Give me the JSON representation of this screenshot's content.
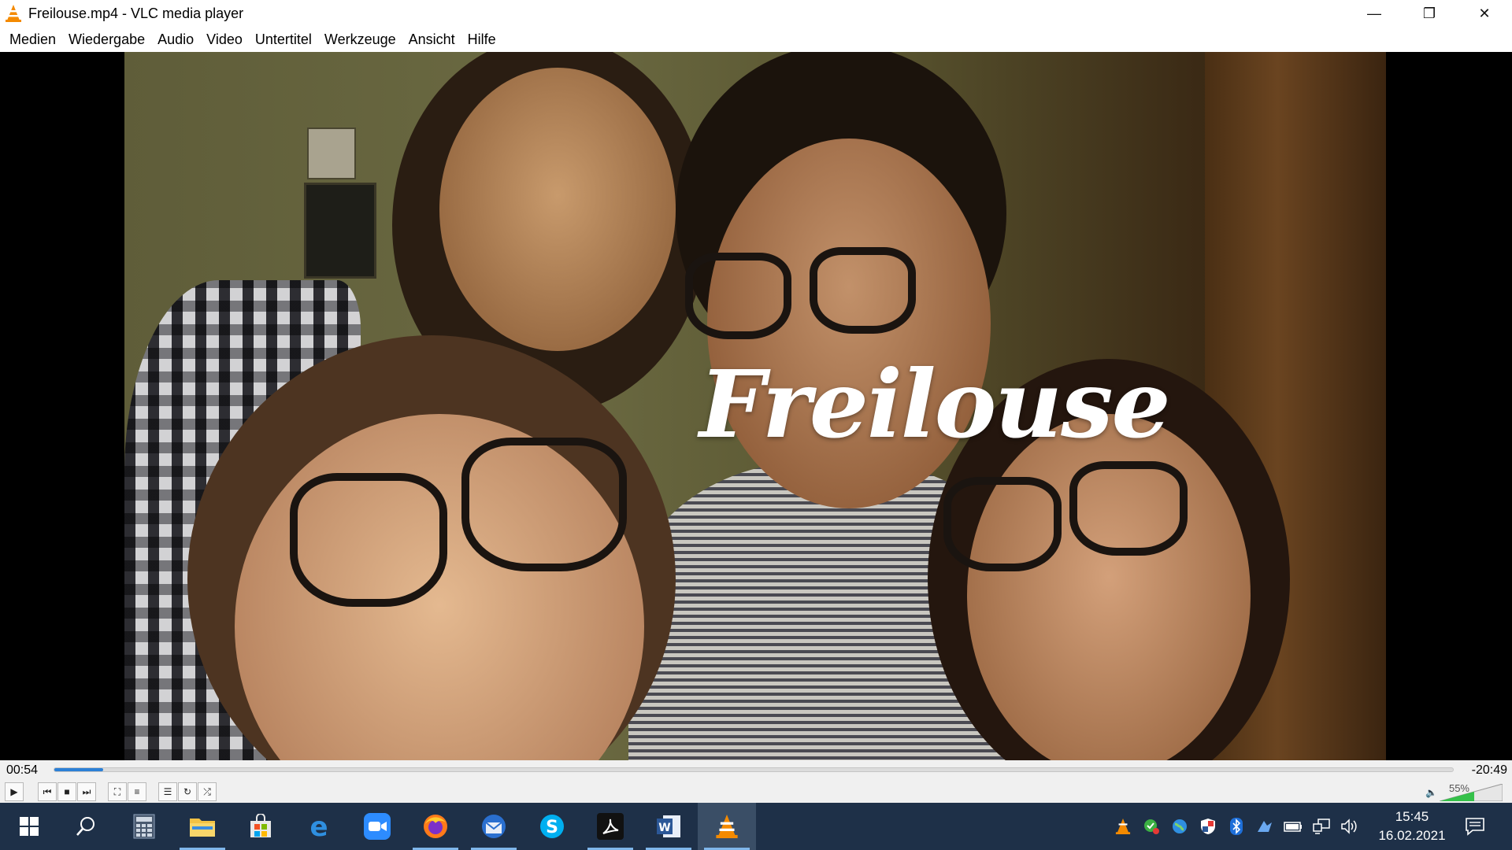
{
  "window": {
    "title": "Freilouse.mp4 - VLC media player",
    "minimize_label": "—",
    "restore_label": "❐",
    "close_label": "✕"
  },
  "menu": [
    "Medien",
    "Wiedergabe",
    "Audio",
    "Video",
    "Untertitel",
    "Werkzeuge",
    "Ansicht",
    "Hilfe"
  ],
  "video": {
    "overlay_text": "Freilouse"
  },
  "player": {
    "elapsed": "00:54",
    "remaining": "-20:49",
    "progress_fraction": 0.035,
    "volume_label": "55%",
    "volume_fraction": 0.55
  },
  "controls": {
    "play": "▶",
    "prev": "⏮",
    "stop": "■",
    "next": "⏭",
    "fullscreen": "⛶",
    "extended": "≡",
    "playlist": "☰",
    "loop": "↻",
    "random": "⤮"
  },
  "taskbar": {
    "clock_time": "15:45",
    "clock_date": "16.02.2021"
  },
  "colors": {
    "accent": "#2b7fd6",
    "taskbar": "#1e3048",
    "vlc_orange": "#f48a00"
  }
}
